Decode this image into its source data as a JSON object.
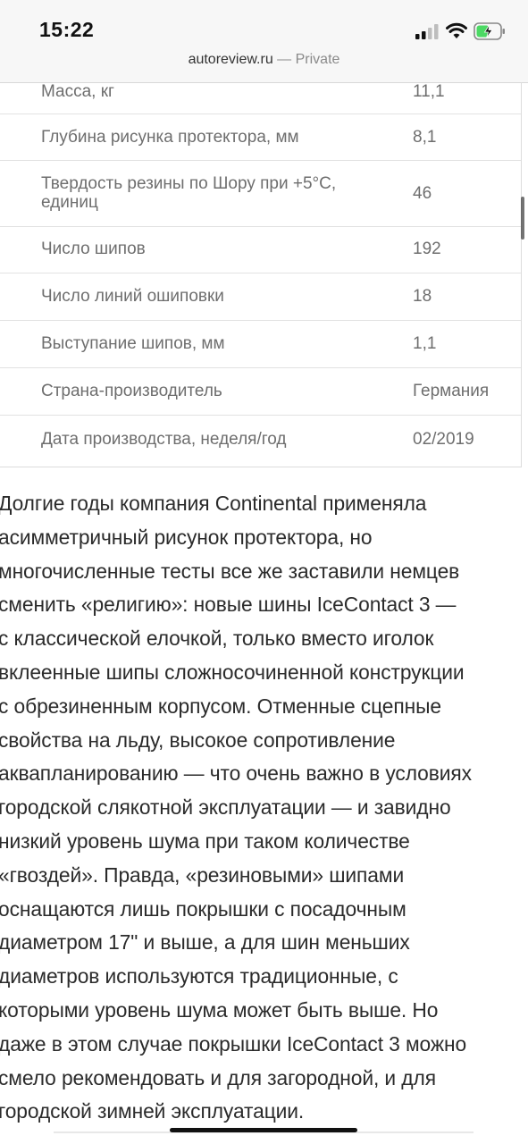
{
  "status_bar": {
    "time": "15:22",
    "url_domain": "autoreview.ru",
    "url_suffix": " — Private"
  },
  "colors": {
    "battery_fill": "#4cd964",
    "text_secondary": "#6e6e6e"
  },
  "table": {
    "rows": [
      {
        "label": "Масса, кг",
        "value": "11,1"
      },
      {
        "label": "Глубина рисунка протектора, мм",
        "value": "8,1"
      },
      {
        "label": "Твердость резины по Шору при +5°С, единиц",
        "value": "46"
      },
      {
        "label": "Число шипов",
        "value": "192"
      },
      {
        "label": "Число линий ошиповки",
        "value": "18"
      },
      {
        "label": "Выступание шипов, мм",
        "value": "1,1"
      },
      {
        "label": "Страна-производитель",
        "value": "Германия"
      },
      {
        "label": "Дата производства, неделя/год",
        "value": "02/2019"
      }
    ]
  },
  "article": {
    "lines": [
      "Долгие годы компания Continental применяла",
      "асимметричный рисунок протектора, но",
      "многочисленные тесты все же заставили немцев",
      "сменить «религию»: новые шины IceContact 3 —",
      "с классической елочкой, только вместо иголок",
      "вклеенные шипы сложносочиненной конструкции",
      "с обрезиненным корпусом. Отменные сцепные",
      "свойства на льду, высокое сопротивление",
      "аквапланированию — что очень важно в условиях",
      "городской слякотной эксплуатации — и завидно",
      "низкий уровень шума при таком количестве",
      "«гвоздей». Правда, «резиновыми» шипами",
      "оснащаются лишь покрышки с посадочным",
      "диаметром 17\" и выше, а для шин меньших",
      "диаметров используются традиционные, с",
      "которыми уровень шума может быть выше. Но",
      "даже в этом случае покрышки IceContact 3 можно",
      "смело рекомендовать и для загородной, и для",
      "городской зимней эксплуатации."
    ]
  }
}
